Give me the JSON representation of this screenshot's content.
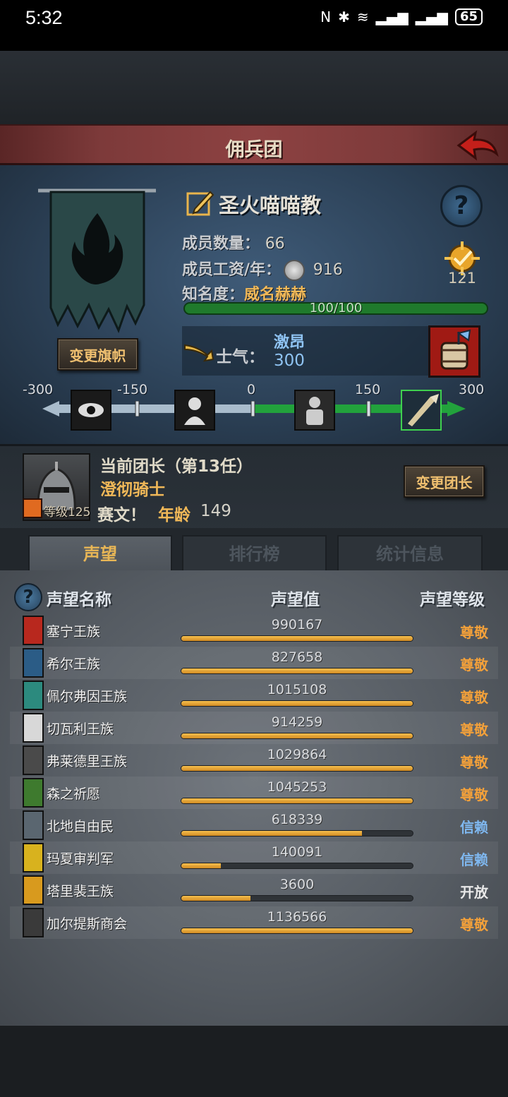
{
  "statusbar": {
    "time": "5:32",
    "battery": "65"
  },
  "header": {
    "title": "佣兵团"
  },
  "guild": {
    "name": "圣火喵喵教",
    "members_label": "成员数量：",
    "members_value": "66",
    "salary_label": "成员工资/年：",
    "salary_value": "916",
    "fame_label": "知名度：",
    "fame_value": "威名赫赫",
    "fame_progress_text": "100/100",
    "fame_progress": 1.0,
    "medal_value": "121",
    "change_banner_button": "变更旗帜",
    "morale_label": "士气：",
    "morale_word": "激昂",
    "morale_value": "300"
  },
  "morale_scale": {
    "labels": [
      "-300",
      "-150",
      "0",
      "150",
      "300"
    ],
    "current": 300
  },
  "leader": {
    "title": "当前团长（第13任）",
    "class": "澄彻骑士",
    "level_text": "等级125",
    "name": "赛文！",
    "age_label": "年龄",
    "age_value": "149",
    "change_button": "变更团长"
  },
  "tabs": [
    {
      "label": "声望",
      "active": true
    },
    {
      "label": "排行榜",
      "active": false
    },
    {
      "label": "统计信息",
      "active": false
    }
  ],
  "table": {
    "col_name": "声望名称",
    "col_value": "声望值",
    "col_level": "声望等级",
    "rows": [
      {
        "name": "塞宁王族",
        "value": "990167",
        "fill": 1.0,
        "level": "尊敬",
        "level_color": "#f2a03a",
        "crest_color": "#b8281e"
      },
      {
        "name": "希尔王族",
        "value": "827658",
        "fill": 1.0,
        "level": "尊敬",
        "level_color": "#f2a03a",
        "crest_color": "#2b5c86"
      },
      {
        "name": "佩尔弗因王族",
        "value": "1015108",
        "fill": 1.0,
        "level": "尊敬",
        "level_color": "#f2a03a",
        "crest_color": "#2c8a7e"
      },
      {
        "name": "切瓦利王族",
        "value": "914259",
        "fill": 1.0,
        "level": "尊敬",
        "level_color": "#f2a03a",
        "crest_color": "#d8d8d8"
      },
      {
        "name": "弗莱德里王族",
        "value": "1029864",
        "fill": 1.0,
        "level": "尊敬",
        "level_color": "#f2a03a",
        "crest_color": "#4a4a4a"
      },
      {
        "name": "森之祈愿",
        "value": "1045253",
        "fill": 1.0,
        "level": "尊敬",
        "level_color": "#f2a03a",
        "crest_color": "#3e7a2e"
      },
      {
        "name": "北地自由民",
        "value": "618339",
        "fill": 0.78,
        "level": "信赖",
        "level_color": "#7fb8f0",
        "crest_color": "#5a6670"
      },
      {
        "name": "玛夏审判军",
        "value": "140091",
        "fill": 0.17,
        "level": "信赖",
        "level_color": "#7fb8f0",
        "crest_color": "#d8b21e"
      },
      {
        "name": "塔里裴王族",
        "value": "3600",
        "fill": 0.3,
        "level": "开放",
        "level_color": "#e8e8e8",
        "crest_color": "#d89a1e"
      },
      {
        "name": "加尔提斯商会",
        "value": "1136566",
        "fill": 1.0,
        "level": "尊敬",
        "level_color": "#f2a03a",
        "crest_color": "#3a3a3a"
      }
    ]
  }
}
